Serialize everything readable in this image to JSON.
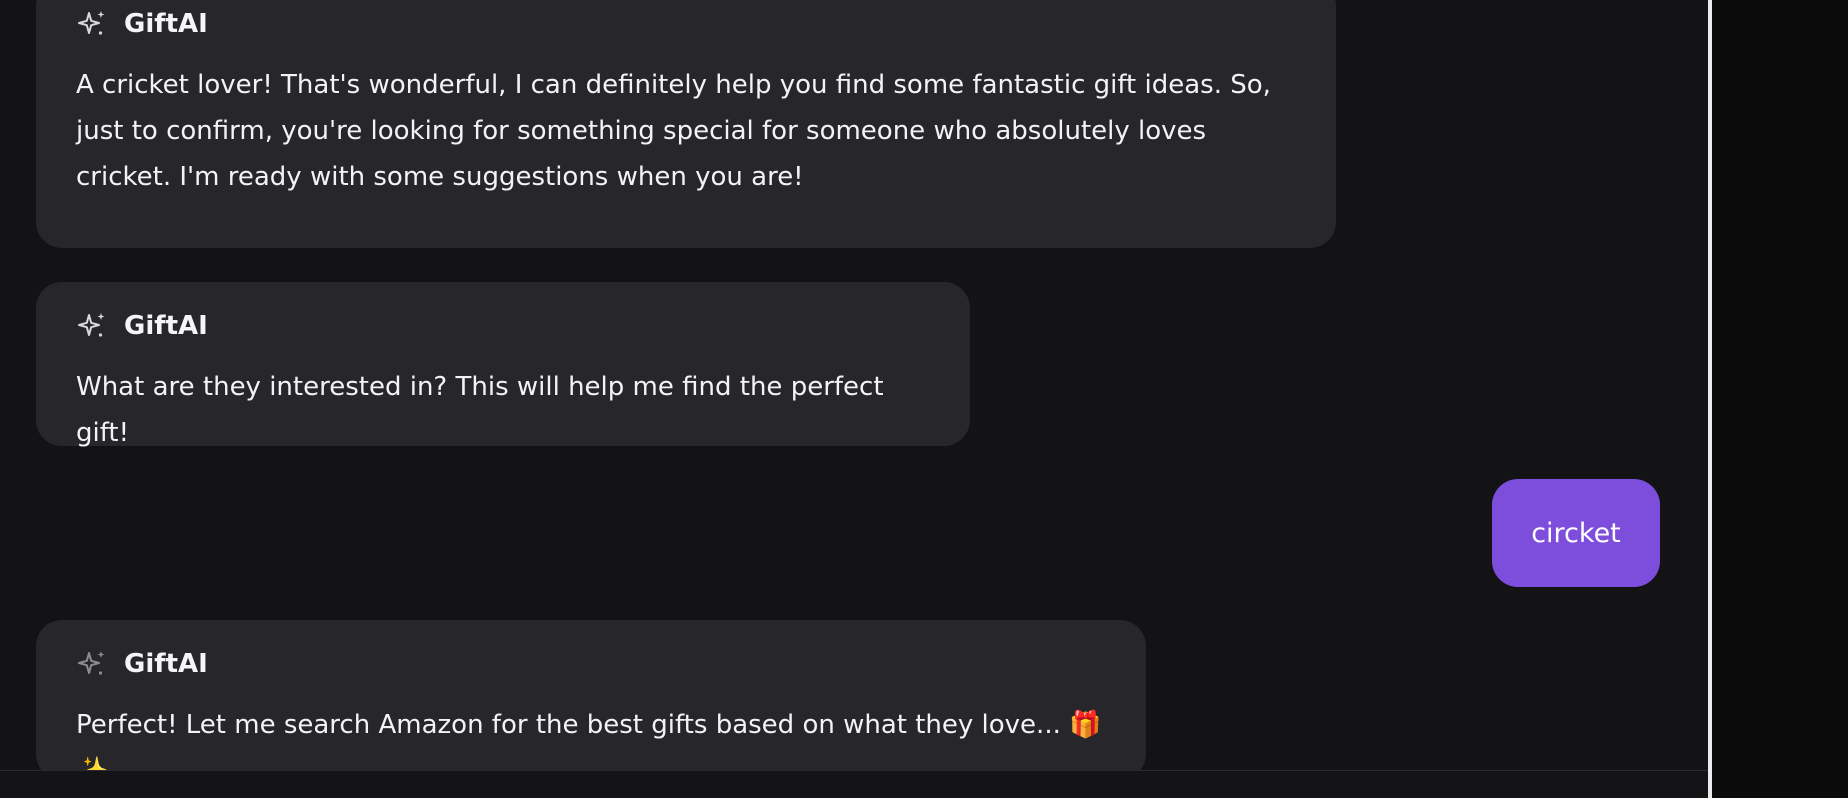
{
  "colors": {
    "background": "#131315",
    "assistant_bubble": "#27272b",
    "user_bubble": "#7c4edb",
    "divider": "#ececec",
    "text": "#f3f3f5"
  },
  "messages": [
    {
      "role": "assistant",
      "sender": "GiftAI",
      "icon": "sparkle-icon",
      "text": "A cricket lover! That's wonderful, I can definitely help you find some fantastic gift ideas. So, just to confirm, you're looking for something special for someone who absolutely loves cricket. I'm ready with some suggestions when you are!"
    },
    {
      "role": "assistant",
      "sender": "GiftAI",
      "icon": "sparkle-icon",
      "text": "What are they interested in? This will help me find the perfect gift!"
    },
    {
      "role": "user",
      "text": "circket"
    },
    {
      "role": "assistant",
      "sender": "GiftAI",
      "icon": "sparkle-icon",
      "text": "Perfect! Let me search Amazon for the best gifts based on what they love... 🎁✨"
    }
  ]
}
